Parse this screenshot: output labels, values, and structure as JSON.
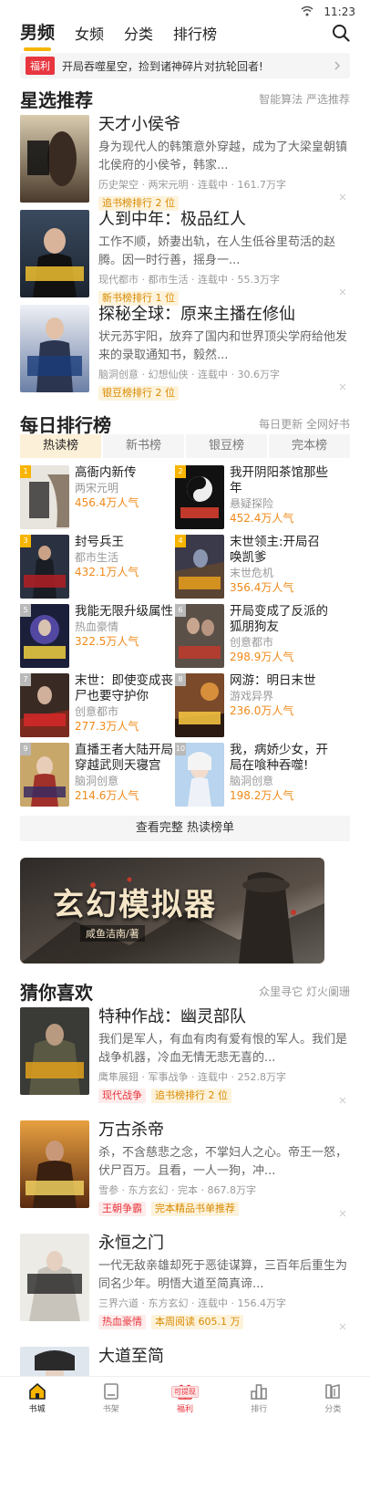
{
  "status": {
    "time": "11:23"
  },
  "topnav": {
    "tabs": [
      "男频",
      "女频",
      "分类",
      "排行榜"
    ]
  },
  "notice": {
    "tag": "福利",
    "text": "开局吞噬星空，捡到诸神碎片对抗轮回者!"
  },
  "featured": {
    "title": "星选推荐",
    "subtitle": "智能算法 严选推荐",
    "books": [
      {
        "name": "天才小侯爷",
        "desc": "身为现代人的韩策意外穿越，成为了大梁皇朝镇北侯府的小侯爷，韩家...",
        "meta": "历史架空 · 两宋元明 · 连载中 · 161.7万字",
        "badge": "追书榜排行 2 位"
      },
      {
        "name": "人到中年：极品红人",
        "desc": "工作不顺，娇妻出轨，在人生低谷里苟活的赵腾。因一时行善，摇身一...",
        "meta": "现代都市 · 都市生活 · 连载中 · 55.3万字",
        "badge": "新书榜排行 1 位"
      },
      {
        "name": "探秘全球：原来主播在修仙",
        "desc": "状元苏宇阳，放弃了国内和世界顶尖学府给他发来的录取通知书，毅然...",
        "meta": "脑洞创意 · 幻想仙侠 · 连载中 · 30.6万字",
        "badge": "银豆榜排行 2 位"
      }
    ]
  },
  "ranking": {
    "title": "每日排行榜",
    "subtitle": "每日更新 全网好书",
    "tabs": [
      "热读榜",
      "新书榜",
      "银豆榜",
      "完本榜"
    ],
    "items": [
      {
        "num": "1",
        "name": "高衙内新传",
        "genre": "两宋元明",
        "pop": "456.4万人气"
      },
      {
        "num": "2",
        "name": "我开阴阳茶馆那些年",
        "genre": "悬疑探险",
        "pop": "452.4万人气"
      },
      {
        "num": "3",
        "name": "封号兵王",
        "genre": "都市生活",
        "pop": "432.1万人气"
      },
      {
        "num": "4",
        "name": "末世领主:开局召唤凯爹",
        "genre": "末世危机",
        "pop": "356.4万人气"
      },
      {
        "num": "5",
        "name": "我能无限升级属性",
        "genre": "热血豪情",
        "pop": "322.5万人气"
      },
      {
        "num": "6",
        "name": "开局变成了反派的狐朋狗友",
        "genre": "创意都市",
        "pop": "298.9万人气"
      },
      {
        "num": "7",
        "name": "末世：即使变成丧尸也要守护你",
        "genre": "创意都市",
        "pop": "277.3万人气"
      },
      {
        "num": "8",
        "name": "网游：明日末世",
        "genre": "游戏异界",
        "pop": "236.0万人气"
      },
      {
        "num": "9",
        "name": "直播王者大陆开局穿越武则天寝宫",
        "genre": "脑洞创意",
        "pop": "214.6万人气"
      },
      {
        "num": "10",
        "name": "我，病娇少女，开局在喰种吞噬!",
        "genre": "脑洞创意",
        "pop": "198.2万人气"
      }
    ],
    "view_all": "查看完整 热读榜单"
  },
  "banner": {
    "title": "玄幻模拟器",
    "author": "咸鱼洁南/著"
  },
  "guess": {
    "title": "猜你喜欢",
    "subtitle": "众里寻它 灯火阑珊",
    "books": [
      {
        "name": "特种作战：幽灵部队",
        "desc": "我们是军人，有血有肉有爱有恨的军人。我们是战争机器，冷血无情无悲无喜的...",
        "meta": "鹰隼展翅 · 军事战争 · 连载中 · 252.8万字",
        "badges": [
          "现代战争",
          "追书榜排行 2 位"
        ]
      },
      {
        "name": "万古杀帝",
        "desc": "杀，不含慈悲之念，不掌妇人之心。帝王一怒，伏尸百万。且看，一人一狗，冲...",
        "meta": "雪参 · 东方玄幻 · 完本 · 867.8万字",
        "badges": [
          "王朝争霸",
          "完本精品书单推荐"
        ]
      },
      {
        "name": "永恒之门",
        "desc": "一代无敌亲雄却死于恶徒谋算，三百年后重生为同名少年。明悟大道至简真谛...",
        "meta": "三界六道 · 东方玄幻 · 连载中 · 156.4万字",
        "badges": [
          "热血豪情",
          "本周阅读 605.1 万"
        ]
      },
      {
        "name": "大道至简",
        "desc": "",
        "meta": "",
        "badges": []
      }
    ]
  },
  "tabbar": {
    "items": [
      "书城",
      "书架",
      "福利",
      "排行",
      "分类"
    ],
    "welfare_tag": "可提现"
  },
  "colors": {
    "accent": "#f7b500",
    "red": "#e8363f",
    "orange_pop": "#f08a1a"
  }
}
